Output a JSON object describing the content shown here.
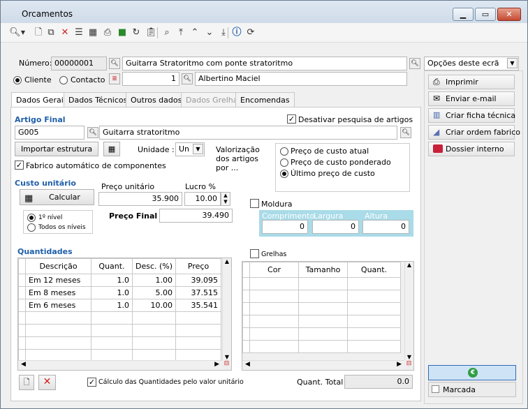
{
  "window": {
    "title": "Orcamentos"
  },
  "header": {
    "numero_label": "Número:",
    "numero": "00000001",
    "descricao": "Guitarra Stratoritmo com ponte stratoritmo",
    "cliente_label": "Cliente",
    "contacto_label": "Contacto",
    "contact_num": "1",
    "contact_name": "Albertino Maciel"
  },
  "tabs": [
    {
      "label": "Dados Gerais"
    },
    {
      "label": "Dados Técnicos"
    },
    {
      "label": "Outros dados"
    },
    {
      "label": "Dados Grelha"
    },
    {
      "label": "Encomendas"
    }
  ],
  "artigo": {
    "section": "Artigo Final",
    "desativar": "Desativar pesquisa de artigos",
    "code": "G005",
    "name": "Guitarra stratoritmo",
    "importar": "Importar estrutura",
    "unidade_label": "Unidade :",
    "unidade": "Un",
    "valorizacao": "Valorização dos artigos por ...",
    "fabrico": "Fabrico automático de componentes",
    "options": [
      "Preço de custo atual",
      "Preço de custo ponderado",
      "Último preço de custo"
    ]
  },
  "custo": {
    "section": "Custo unitário",
    "calcular": "Calcular",
    "preco_label": "Preço unitário",
    "preco": "35.900",
    "lucro_label": "Lucro %",
    "lucro": "10.00",
    "nivel1": "1º nível",
    "todos": "Todos os níveis",
    "final_label": "Preço Final :",
    "final": "39.490"
  },
  "moldura": {
    "label": "Moldura",
    "comprimento_label": "Comprimento",
    "largura_label": "Largura",
    "altura_label": "Altura",
    "comprimento": "0",
    "largura": "0",
    "altura": "0"
  },
  "quantidades": {
    "section": "Quantidades",
    "headers": [
      "Descrição",
      "Quant.",
      "Desc. (%)",
      "Preço"
    ],
    "rows": [
      [
        "Em 12 meses",
        "1.0",
        "1.00",
        "39.095"
      ],
      [
        "Em 8 meses",
        "1.0",
        "5.00",
        "37.515"
      ],
      [
        "Em 6 meses",
        "1.0",
        "10.00",
        "35.541"
      ]
    ],
    "calculo": "Cálculo das Quantidades pelo valor unitário"
  },
  "grelhas": {
    "label": "Grelhas",
    "headers": [
      "Cor",
      "Tamanho",
      "Quant."
    ],
    "quant_total_label": "Quant. Total",
    "quant_total": "0.0"
  },
  "right": {
    "opcoes": "Opções deste ecrã",
    "buttons": [
      "Imprimir",
      "Enviar e-mail",
      "Criar ficha técnica",
      "Criar ordem fabrico",
      "Dossier interno"
    ],
    "marcada": "Marcada"
  },
  "colors": {
    "accent": "#1f5fa9",
    "moldura_bg": "#a9dbe8",
    "euro_green": "#2f9e44"
  }
}
